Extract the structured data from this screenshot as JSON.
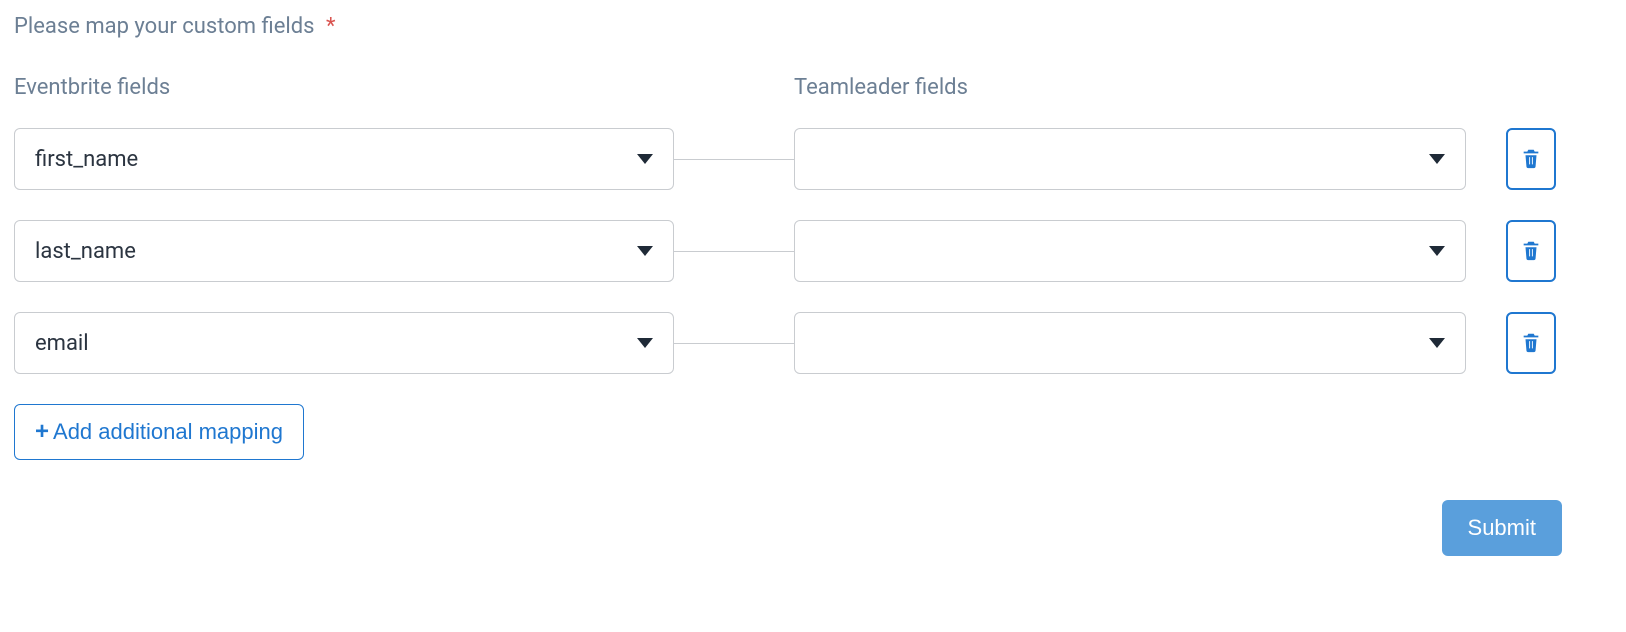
{
  "heading": "Please map your custom fields",
  "required_marker": "*",
  "columns": {
    "left_label": "Eventbrite fields",
    "right_label": "Teamleader fields"
  },
  "rows": [
    {
      "source_value": "first_name",
      "target_value": ""
    },
    {
      "source_value": "last_name",
      "target_value": ""
    },
    {
      "source_value": "email",
      "target_value": ""
    }
  ],
  "add_button_label": "Add additional mapping",
  "submit_label": "Submit"
}
